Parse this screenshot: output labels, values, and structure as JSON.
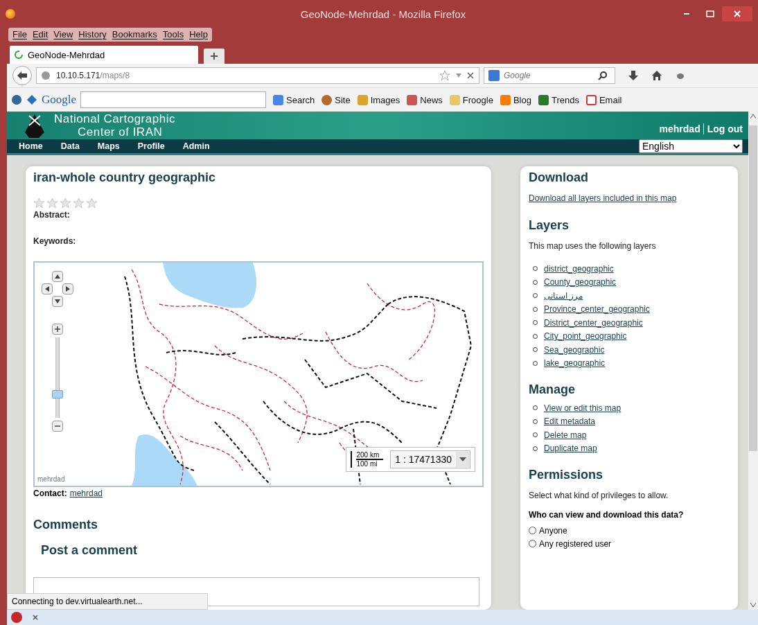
{
  "window": {
    "title": "GeoNode-Mehrdad - Mozilla Firefox"
  },
  "menu": [
    "File",
    "Edit",
    "View",
    "History",
    "Bookmarks",
    "Tools",
    "Help"
  ],
  "tab": {
    "title": "GeoNode-Mehrdad"
  },
  "address": {
    "host": "10.10.5.171",
    "path": "/maps/8"
  },
  "search": {
    "placeholder": "Google"
  },
  "bookmarks": {
    "google": "Google",
    "items": [
      {
        "kind": "search",
        "label": "Search"
      },
      {
        "kind": "site",
        "label": "Site"
      },
      {
        "kind": "images",
        "label": "Images"
      },
      {
        "kind": "news",
        "label": "News"
      },
      {
        "kind": "froogle",
        "label": "Froogle"
      },
      {
        "kind": "blog",
        "label": "Blog"
      },
      {
        "kind": "trends",
        "label": "Trends"
      },
      {
        "kind": "email",
        "label": "Email"
      }
    ]
  },
  "site": {
    "logo_line1": "National Cartographic",
    "logo_line2": "Center of IRAN",
    "user": "mehrdad",
    "logout": "Log out",
    "nav": [
      "Home",
      "Data",
      "Maps",
      "Profile",
      "Admin"
    ],
    "language": "English"
  },
  "map_page": {
    "title": "iran-whole country geographic",
    "stars": 0,
    "abstract_label": "Abstract:",
    "keywords_label": "Keywords:",
    "map": {
      "attribution": "mehrdad",
      "scale_km": "200 km",
      "scale_mi": "100 mi",
      "scale_ratio": "1 : 17471330",
      "zoom": {
        "level": 0.27
      }
    },
    "contact_label": "Contact:",
    "contact": "mehrdad",
    "comments": "Comments",
    "post_comment": "Post a comment"
  },
  "sidebar": {
    "download": {
      "heading": "Download",
      "link": "Download all layers included in this map"
    },
    "layers": {
      "heading": "Layers",
      "intro": "This map uses the following layers",
      "items": [
        "district_geographic",
        "County_geographic",
        "مرز استانی",
        "Province_center_geographic",
        "District_center_geographic",
        "City_point_geographic",
        "Sea_geographic",
        "lake_geographic"
      ]
    },
    "manage": {
      "heading": "Manage",
      "items": [
        "View or edit this map",
        "Edit metadata",
        "Delete map",
        "Duplicate map"
      ]
    },
    "permissions": {
      "heading": "Permissions",
      "intro": "Select what kind of privileges to allow.",
      "question": "Who can view and download this data?",
      "options": [
        {
          "label": "Anyone",
          "selected": false
        },
        {
          "label": "Any registered user",
          "selected": false
        }
      ]
    }
  },
  "status": {
    "message": "Connecting to dev.virtualearth.net..."
  }
}
